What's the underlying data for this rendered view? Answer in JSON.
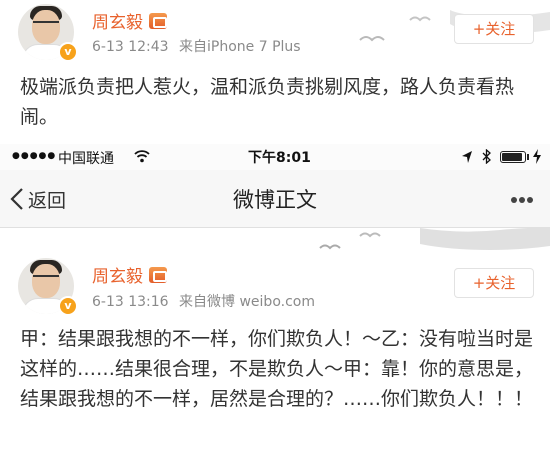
{
  "post_top": {
    "author": "周玄毅",
    "verified_badge": "v",
    "time": "6-13 12:43",
    "source": "来自iPhone 7 Plus",
    "follow_label": "+关注",
    "text": "极端派负责把人惹火，温和派负责挑剔风度，路人负责看热闹。"
  },
  "statusbar": {
    "signal": "●●●●●",
    "carrier": "中国联通",
    "time": "下午8:01",
    "battery_level": 0.95
  },
  "navbar": {
    "back_label": "返回",
    "title": "微博正文"
  },
  "post_bottom": {
    "author": "周玄毅",
    "verified_badge": "v",
    "time": "6-13 13:16",
    "source": "来自微博 weibo.com",
    "follow_label": "+关注",
    "text": "甲：结果跟我想的不一样，你们欺负人！～乙：没有啦当时是这样的……结果很合理，不是欺负人～甲：靠！你的意思是，结果跟我想的不一样，居然是合理的？……你们欺负人！！！"
  },
  "colors": {
    "name": "#e8622d",
    "meta": "#8a8a8a",
    "badge": "#f7a21b"
  }
}
